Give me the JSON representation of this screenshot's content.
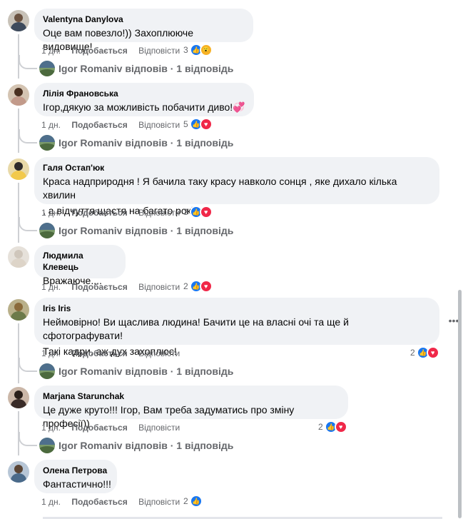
{
  "comments": [
    {
      "author": "Valentyna Danylova",
      "text": [
        "Оце вам повезло!)) Захоплююче видовище!"
      ],
      "time": "1 дн.",
      "like": "Подобається",
      "reply": "Відповісти",
      "reaction_count": "3",
      "reactions": [
        "like-icon",
        "wow-icon"
      ],
      "reply_summary": "Igor Romaniv відповів · 1 відповідь"
    },
    {
      "author": "Лілія Франовська",
      "text": [
        "Ігор,дякую за можливість побачити диво!💞"
      ],
      "time": "1 дн.",
      "like": "Подобається",
      "reply": "Відповісти",
      "reaction_count": "5",
      "reactions": [
        "like-icon",
        "love-icon"
      ],
      "reply_summary": "Igor Romaniv відповів · 1 відповідь"
    },
    {
      "author": "Галя Остап'юк",
      "text": [
        "Краса надприродня ! Я бачила таку красу навколо сонця , яке дихало кілька хвилин",
        ", а відчуття щастя на багато років!"
      ],
      "time": "1 дн.",
      "like": "Подобається",
      "reply": "Відповісти",
      "reaction_count": "3",
      "reactions": [
        "like-icon",
        "love-icon"
      ],
      "reply_summary": "Igor Romaniv відповів · 1 відповідь"
    },
    {
      "author": "Людмила Клевець",
      "text": [
        "Вражаюче...."
      ],
      "time": "1 дн.",
      "like": "Подобається",
      "reply": "Відповісти",
      "reaction_count": "2",
      "reactions": [
        "like-icon",
        "love-icon"
      ]
    },
    {
      "author": "Iris Iris",
      "text": [
        "Неймовірно! Ви щаслива людина! Бачити це на власні очі та ще й сфотографувати!",
        "Такі кадри, аж дух захоплює!"
      ],
      "time": "1 дн.",
      "like": "Подобається",
      "reply": "Відповісти",
      "reaction_count": "2",
      "reactions": [
        "like-icon",
        "love-icon"
      ],
      "reply_summary": "Igor Romaniv відповів · 1 відповідь"
    },
    {
      "author": "Marjana Starunchak",
      "text": [
        "Це дуже круто!!! Ігор, Вам треба задуматись про зміну професії))"
      ],
      "time": "1 дн.",
      "like": "Подобається",
      "reply": "Відповісти",
      "reaction_count": "2",
      "reactions": [
        "like-icon",
        "love-icon"
      ],
      "reply_summary": "Igor Romaniv відповів · 1 відповідь"
    },
    {
      "author": "Олена Петрова",
      "text": [
        "Фантастично!!!"
      ],
      "time": "1 дн.",
      "like": "Подобається",
      "reply": "Відповісти",
      "reaction_count": "2",
      "reactions": [
        "like-icon"
      ]
    }
  ],
  "more_options_icon": "more-horizontal-icon",
  "colors": {
    "bubble": "#f0f2f5",
    "meta": "#65676b",
    "like": "#1877f2",
    "love": "#f02849",
    "wow": "#f7b125"
  }
}
